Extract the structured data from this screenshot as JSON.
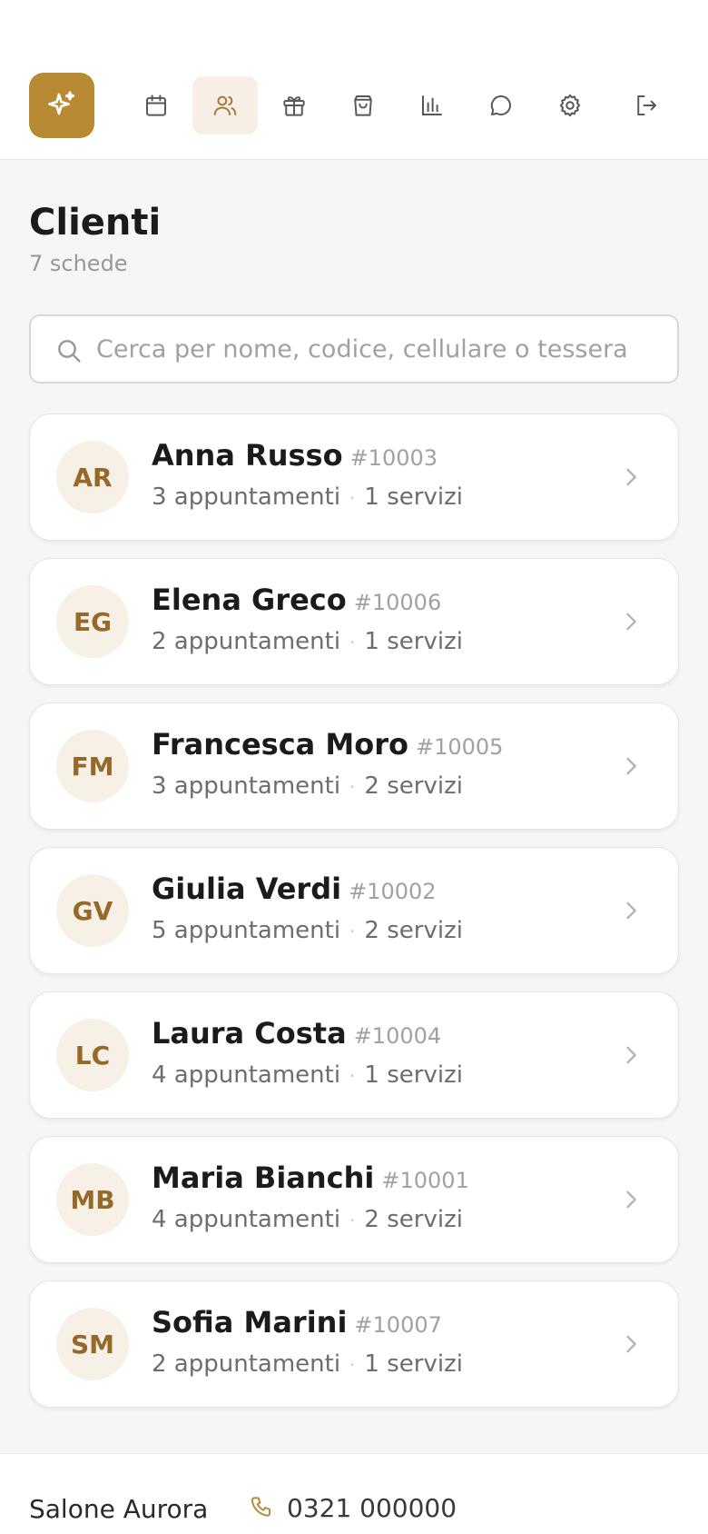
{
  "nav": {
    "brand_icon": "sparkles-icon",
    "items": [
      {
        "icon": "calendar-icon",
        "active": false
      },
      {
        "icon": "users-icon",
        "active": true
      },
      {
        "icon": "gift-icon",
        "active": false
      },
      {
        "icon": "shopping-bag-icon",
        "active": false
      },
      {
        "icon": "bar-chart-icon",
        "active": false
      },
      {
        "icon": "message-icon",
        "active": false
      },
      {
        "icon": "gear-icon",
        "active": false
      },
      {
        "icon": "logout-icon",
        "active": false
      }
    ]
  },
  "page": {
    "title": "Clienti",
    "subtitle": "7 schede"
  },
  "search": {
    "placeholder": "Cerca per nome, codice, cellulare o tessera",
    "value": ""
  },
  "clients": [
    {
      "initials": "AR",
      "name": "Anna Russo",
      "code": "#10003",
      "appointments": "3 appuntamenti",
      "services": "1 servizi"
    },
    {
      "initials": "EG",
      "name": "Elena Greco",
      "code": "#10006",
      "appointments": "2 appuntamenti",
      "services": "1 servizi"
    },
    {
      "initials": "FM",
      "name": "Francesca Moro",
      "code": "#10005",
      "appointments": "3 appuntamenti",
      "services": "2 servizi"
    },
    {
      "initials": "GV",
      "name": "Giulia Verdi",
      "code": "#10002",
      "appointments": "5 appuntamenti",
      "services": "2 servizi"
    },
    {
      "initials": "LC",
      "name": "Laura Costa",
      "code": "#10004",
      "appointments": "4 appuntamenti",
      "services": "1 servizi"
    },
    {
      "initials": "MB",
      "name": "Maria Bianchi",
      "code": "#10001",
      "appointments": "4 appuntamenti",
      "services": "2 servizi"
    },
    {
      "initials": "SM",
      "name": "Sofia Marini",
      "code": "#10007",
      "appointments": "2 appuntamenti",
      "services": "1 servizi"
    }
  ],
  "footer": {
    "salon_name": "Salone Aurora",
    "phone": "0321 000000"
  },
  "colors": {
    "accent": "#b98a34",
    "accent_soft": "#f7efe5",
    "avatar_text": "#94692a",
    "background": "#f6f6f6"
  }
}
